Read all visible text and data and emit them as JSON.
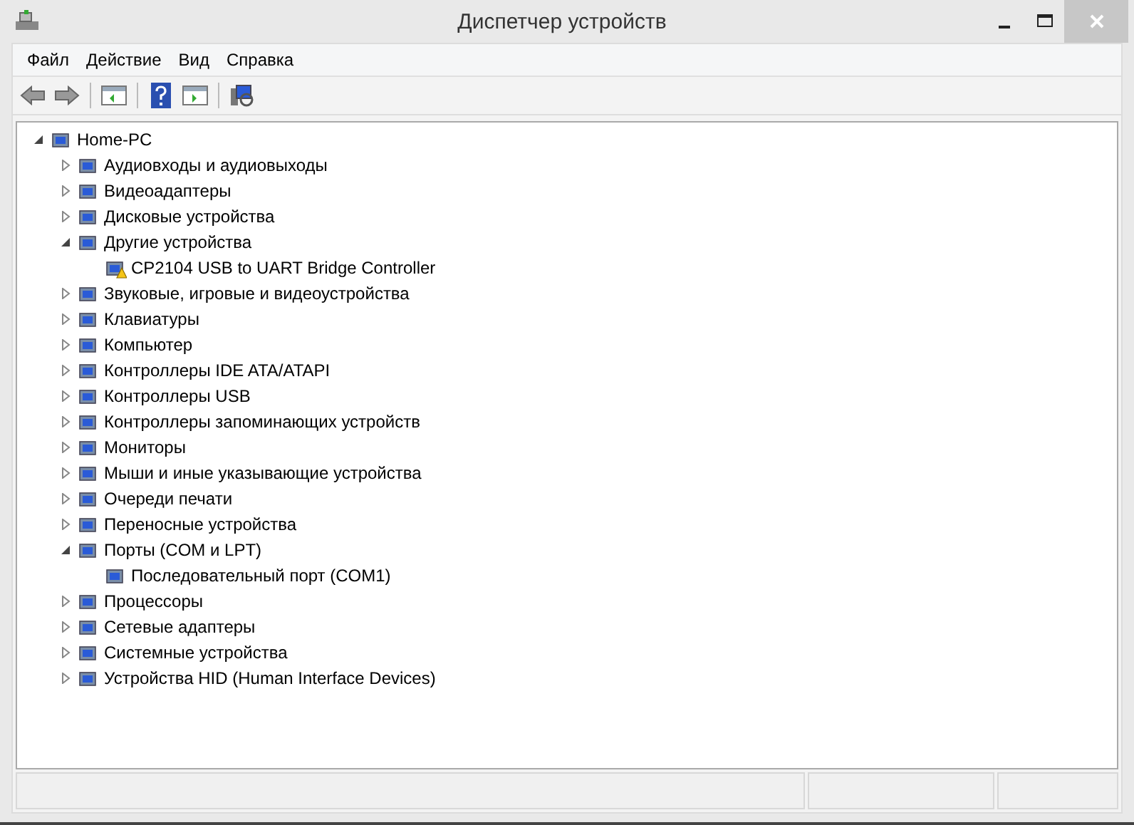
{
  "window": {
    "title": "Диспетчер устройств"
  },
  "menu": [
    "Файл",
    "Действие",
    "Вид",
    "Справка"
  ],
  "tree": [
    {
      "label": "Home-PC",
      "expanded": true,
      "children": [
        {
          "label": "Аудиовходы и аудиовыходы",
          "expanded": false
        },
        {
          "label": "Видеоадаптеры",
          "expanded": false
        },
        {
          "label": "Дисковые устройства",
          "expanded": false
        },
        {
          "label": "Другие устройства",
          "expanded": true,
          "children": [
            {
              "label": "CP2104 USB to UART Bridge Controller",
              "warning": true
            }
          ]
        },
        {
          "label": "Звуковые, игровые и видеоустройства",
          "expanded": false
        },
        {
          "label": "Клавиатуры",
          "expanded": false
        },
        {
          "label": "Компьютер",
          "expanded": false
        },
        {
          "label": "Контроллеры IDE ATA/ATAPI",
          "expanded": false
        },
        {
          "label": "Контроллеры USB",
          "expanded": false
        },
        {
          "label": "Контроллеры запоминающих устройств",
          "expanded": false
        },
        {
          "label": "Мониторы",
          "expanded": false
        },
        {
          "label": "Мыши и иные указывающие устройства",
          "expanded": false
        },
        {
          "label": "Очереди печати",
          "expanded": false
        },
        {
          "label": "Переносные устройства",
          "expanded": false
        },
        {
          "label": "Порты (COM и LPT)",
          "expanded": true,
          "children": [
            {
              "label": "Последовательный порт (COM1)",
              "warning": false
            }
          ]
        },
        {
          "label": "Процессоры",
          "expanded": false
        },
        {
          "label": "Сетевые адаптеры",
          "expanded": false
        },
        {
          "label": "Системные устройства",
          "expanded": false
        },
        {
          "label": "Устройства HID (Human Interface Devices)",
          "expanded": false
        }
      ]
    }
  ]
}
